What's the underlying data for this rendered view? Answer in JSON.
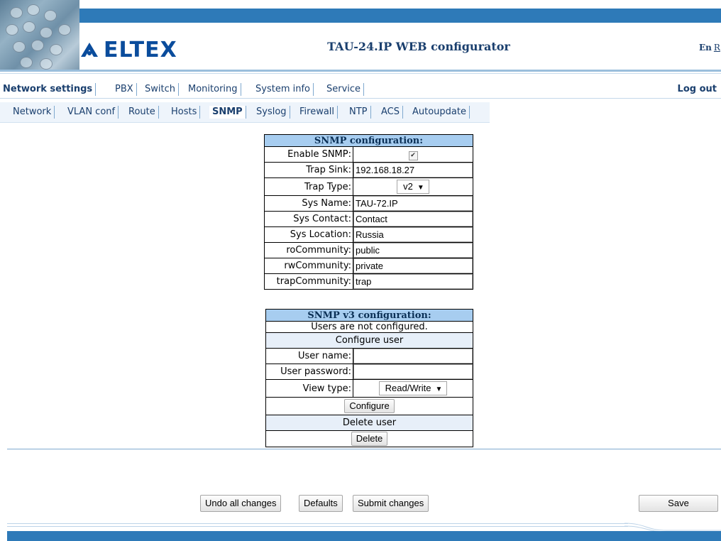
{
  "header": {
    "logo_text": "ELTEX",
    "app_title": "TAU-24.IP WEB configurator",
    "lang_current": "En",
    "lang_other": "R"
  },
  "menu1": {
    "items": [
      "Network settings",
      "PBX",
      "Switch",
      "Monitoring",
      "System info",
      "Service"
    ],
    "active": "Network settings",
    "logout": "Log out"
  },
  "menu2": {
    "items": [
      "Network",
      "VLAN conf",
      "Route",
      "Hosts",
      "SNMP",
      "Syslog",
      "Firewall",
      "NTP",
      "ACS",
      "Autoupdate"
    ],
    "active": "SNMP"
  },
  "snmp": {
    "title": "SNMP configuration:",
    "enable_label": "Enable SNMP:",
    "enable_checked": true,
    "trap_sink_label": "Trap Sink:",
    "trap_sink_value": "192.168.18.27",
    "trap_type_label": "Trap Type:",
    "trap_type_value": "v2",
    "sys_name_label": "Sys Name:",
    "sys_name_value": "TAU-72.IP",
    "sys_contact_label": "Sys Contact:",
    "sys_contact_value": "Contact",
    "sys_location_label": "Sys Location:",
    "sys_location_value": "Russia",
    "ro_label": "roCommunity:",
    "ro_value": "public",
    "rw_label": "rwCommunity:",
    "rw_value": "private",
    "trap_comm_label": "trapCommunity:",
    "trap_comm_value": "trap"
  },
  "snmpv3": {
    "title": "SNMP v3 configuration:",
    "users_status": "Users are not configured.",
    "configure_user_heading": "Configure user",
    "user_name_label": "User name:",
    "user_name_value": "",
    "user_password_label": "User password:",
    "user_password_value": "",
    "view_type_label": "View type:",
    "view_type_value": "Read/Write",
    "configure_button": "Configure",
    "delete_user_heading": "Delete user",
    "delete_button": "Delete"
  },
  "footer": {
    "undo_button": "Undo all changes",
    "defaults_button": "Defaults",
    "submit_button": "Submit changes",
    "save_button": "Save"
  },
  "colors": {
    "brand_blue": "#2e7ab8",
    "table_header": "#a7cdf0",
    "menu_text": "#1a3f6e"
  }
}
